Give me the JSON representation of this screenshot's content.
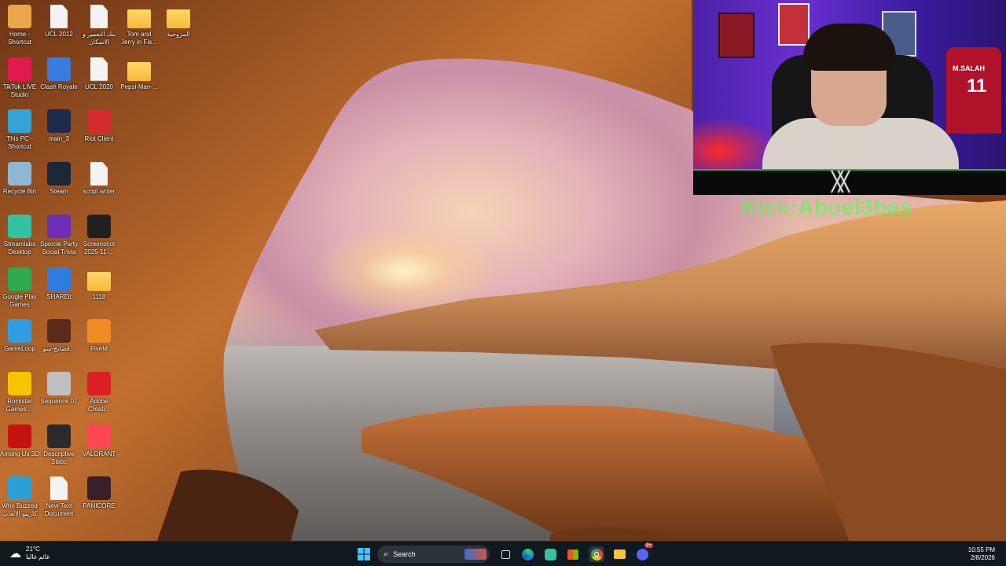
{
  "desktop_icons": [
    {
      "label": "Home - Shortcut",
      "icon": "home-icon",
      "color": "#e9a64a"
    },
    {
      "label": "UCL 2012",
      "icon": "file-icon",
      "color": "#f3f3f3"
    },
    {
      "label": "بنك التعمير و الاسكان",
      "icon": "file-icon",
      "color": "#f3f3f3"
    },
    {
      "label": "Tom and Jerry in Fis...",
      "icon": "folder-icon",
      "color": "#f5c242"
    },
    {
      "label": "المزوجية",
      "icon": "folder-icon",
      "color": "#f5c242"
    },
    {
      "label": "TikTok LIVE Studio",
      "icon": "tiktok-icon",
      "color": "#e01a4f"
    },
    {
      "label": "Clash Royale",
      "icon": "clash-royale-icon",
      "color": "#3a7be0"
    },
    {
      "label": "UCL 2020",
      "icon": "file-icon",
      "color": "#f3f3f3"
    },
    {
      "label": "Pepsi-Man-...",
      "icon": "folder-icon",
      "color": "#f5c242"
    },
    {
      "label": "This PC - Shortcut",
      "icon": "monitor-icon",
      "color": "#36a3d6"
    },
    {
      "label": "main_3",
      "icon": "video-thumb-icon",
      "color": "#1d2a4a"
    },
    {
      "label": "Riot Client",
      "icon": "riot-icon",
      "color": "#d32b2b"
    },
    {
      "label": "Recycle Bin",
      "icon": "recycle-bin-icon",
      "color": "#8fb8d0"
    },
    {
      "label": "Steam",
      "icon": "steam-icon",
      "color": "#1b2838"
    },
    {
      "label": "script writer",
      "icon": "file-icon",
      "color": "#f3f3f3"
    },
    {
      "label": "Streamlabs Desktop",
      "icon": "streamlabs-icon",
      "color": "#31c3a2"
    },
    {
      "label": "Sporcle Party Social Trivia",
      "icon": "party-icon",
      "color": "#6b2fb8"
    },
    {
      "label": "Screenshot 2025-11-...",
      "icon": "image-thumb-icon",
      "color": "#202020"
    },
    {
      "label": "Google Play Games",
      "icon": "play-games-icon",
      "color": "#2fa84f"
    },
    {
      "label": "SHAREit",
      "icon": "shareit-icon",
      "color": "#2f7de0"
    },
    {
      "label": "1118",
      "icon": "folder-icon",
      "color": "#f5c242"
    },
    {
      "label": "GameLoop",
      "icon": "gameloop-icon",
      "color": "#2f9de0"
    },
    {
      "label": "فضايح-سو...",
      "icon": "video-thumb-icon",
      "color": "#5a2a1a"
    },
    {
      "label": "FiveM",
      "icon": "fivem-icon",
      "color": "#f08a24"
    },
    {
      "label": "Rockstar Games ...",
      "icon": "rockstar-icon",
      "color": "#f6c400"
    },
    {
      "label": "Sequence 07",
      "icon": "video-file-icon",
      "color": "#c0c0c0"
    },
    {
      "label": "Adobe Creati...",
      "icon": "adobe-cc-icon",
      "color": "#da1f26"
    },
    {
      "label": "Among Us 3D",
      "icon": "among-us-icon",
      "color": "#c51111"
    },
    {
      "label": "Descriptive Static",
      "icon": "video-thumb-icon",
      "color": "#2a2a2a"
    },
    {
      "label": "VALORANT",
      "icon": "valorant-icon",
      "color": "#ff4655"
    },
    {
      "label": "Who Buzzed كازينو الالعاب",
      "icon": "game-icon",
      "color": "#2aa0d8"
    },
    {
      "label": "New Text Document",
      "icon": "file-icon",
      "color": "#f3f3f3"
    },
    {
      "label": "PANICORE",
      "icon": "panicore-icon",
      "color": "#3a1f2a"
    }
  ],
  "webcam": {
    "jersey_text": "M.SALAH",
    "jersey_number": "11"
  },
  "overlay": {
    "kick_text": "Kick:Aboel3bas"
  },
  "taskbar": {
    "weather_temp": "21°C",
    "weather_desc": "غائم غالبا",
    "search_placeholder": "Search",
    "time": "10:55 PM",
    "date": "2/8/2026",
    "discord_badge": "9+"
  }
}
